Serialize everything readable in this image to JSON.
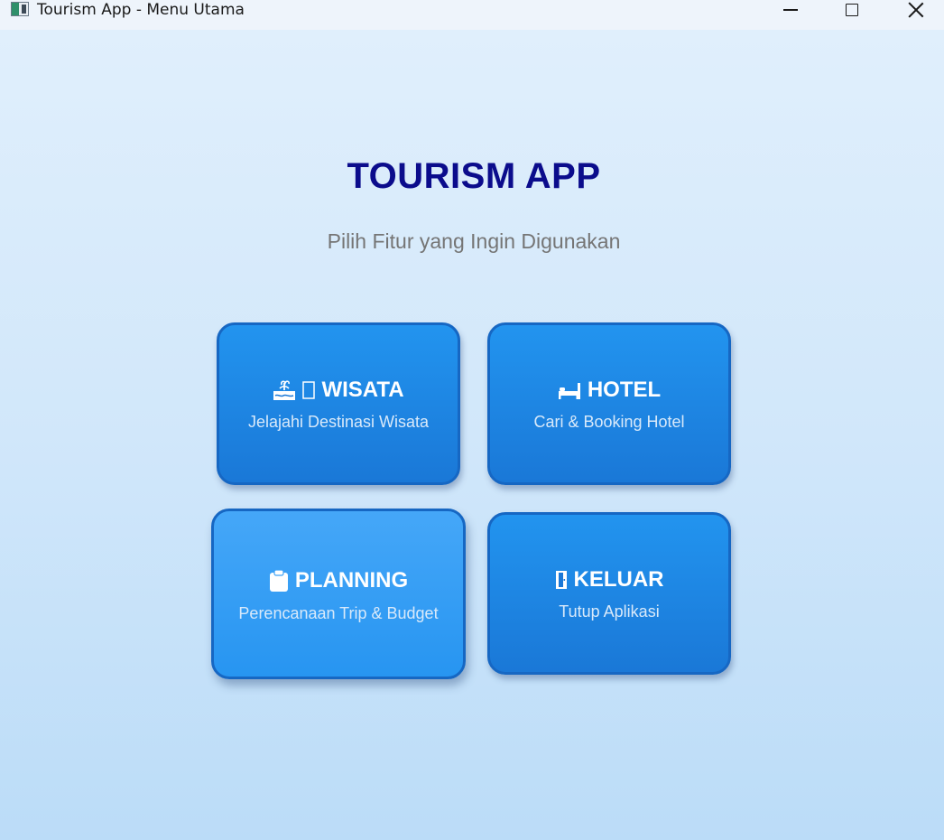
{
  "window": {
    "title": "Tourism App - Menu Utama"
  },
  "header": {
    "title": "TOURISM APP",
    "subtitle": "Pilih Fitur yang Ingin Digunakan"
  },
  "menu": [
    {
      "id": "wisata",
      "icon": "beach-icon",
      "title": "WISATA",
      "description": "Jelajahi Destinasi Wisata"
    },
    {
      "id": "hotel",
      "icon": "bed-icon",
      "title": "HOTEL",
      "description": "Cari & Booking Hotel"
    },
    {
      "id": "planning",
      "icon": "clipboard-icon",
      "title": "PLANNING",
      "description": "Perencanaan Trip & Budget"
    },
    {
      "id": "keluar",
      "icon": "door-icon",
      "title": "KELUAR",
      "description": "Tutup Aplikasi"
    }
  ],
  "colors": {
    "title": "#0b0c8c",
    "subtitle": "#757575",
    "card_fill": "#1e88e5",
    "card_border": "#1667c3",
    "card_hover_fill": "#3fa2f6",
    "background_top": "#e0effc",
    "background_bottom": "#bbdcf8"
  }
}
